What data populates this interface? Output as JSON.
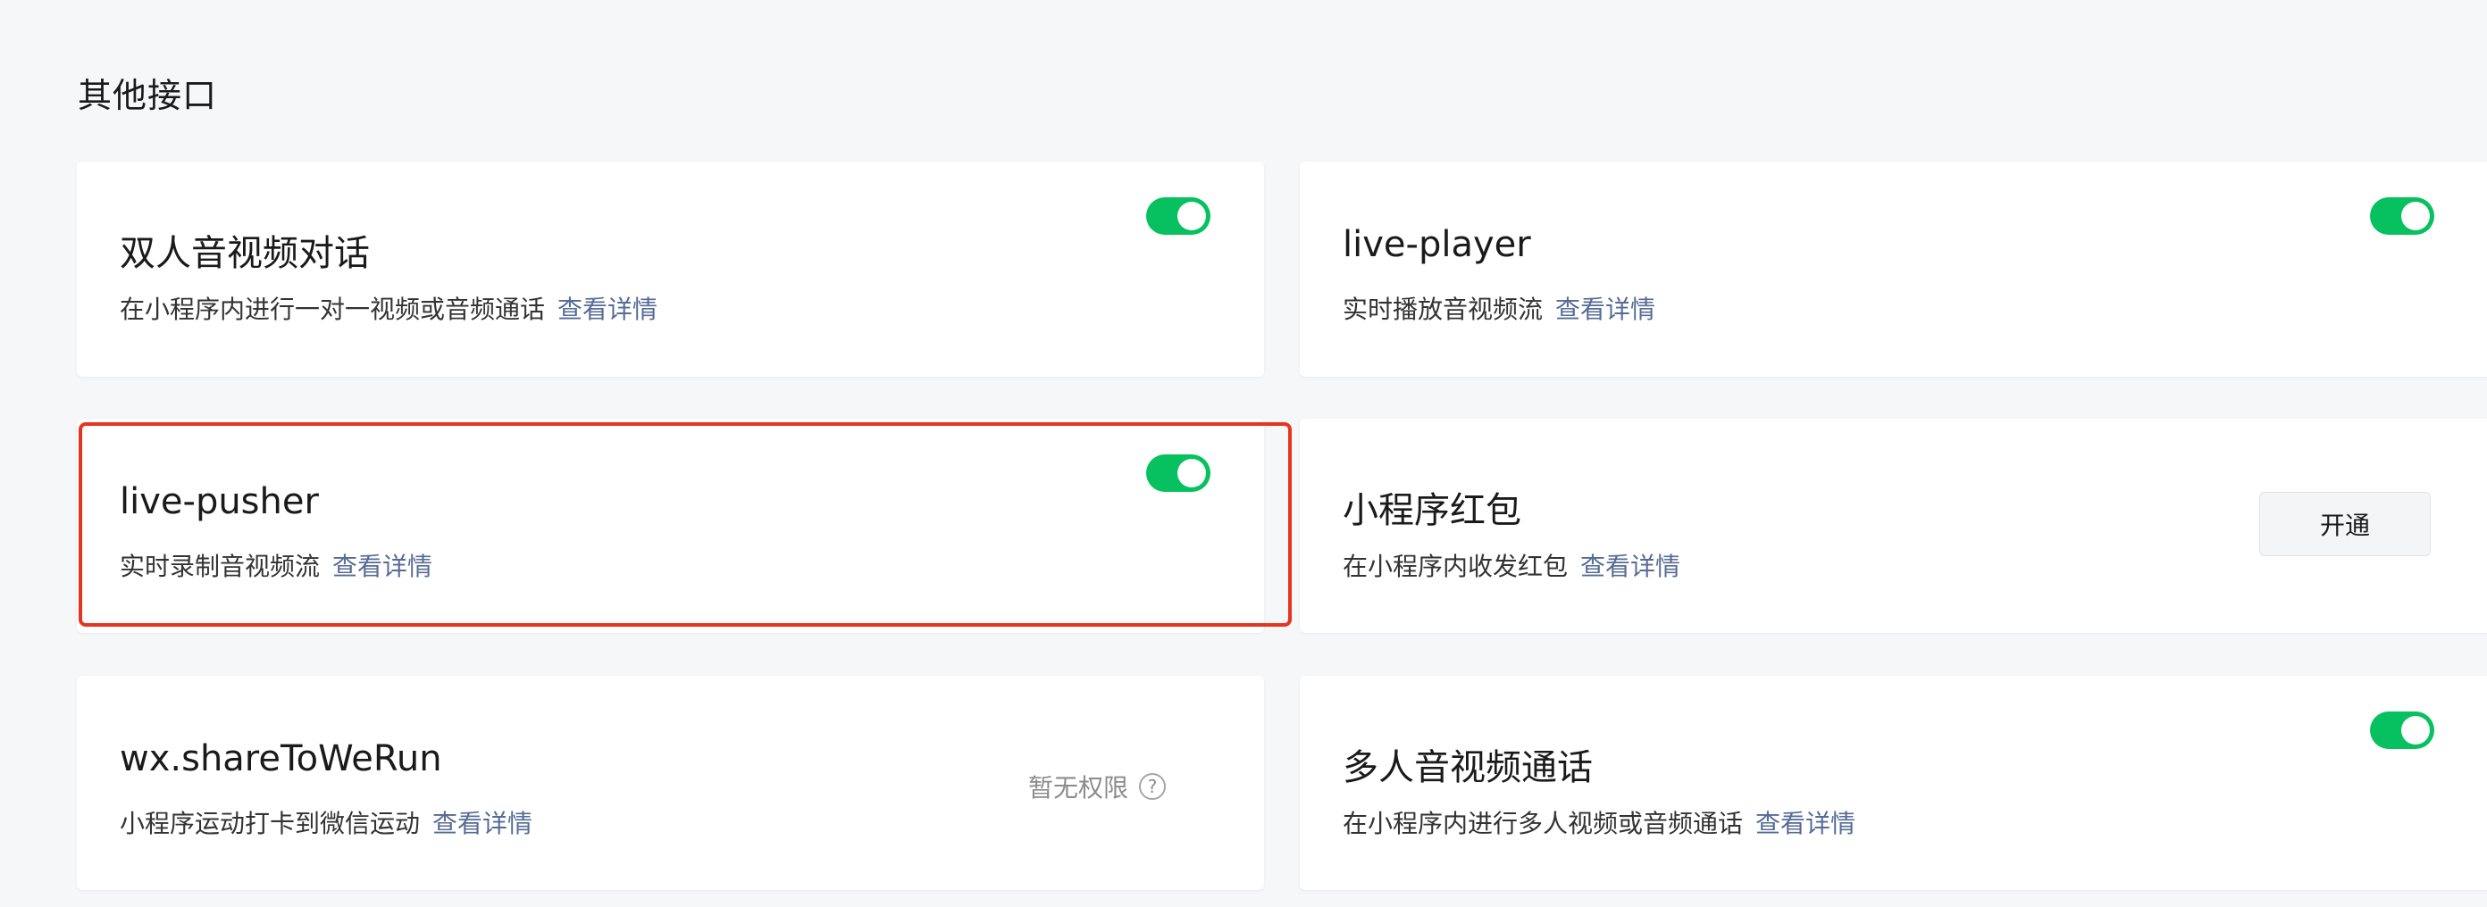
{
  "section": {
    "title": "其他接口"
  },
  "cards": {
    "c1": {
      "title": "双人音视频对话",
      "desc": "在小程序内进行一对一视频或音频通话",
      "link": "查看详情",
      "toggle_on": true
    },
    "c2": {
      "title": "live-player",
      "desc": "实时播放音视频流",
      "link": "查看详情",
      "toggle_on": true
    },
    "c3": {
      "title": "live-pusher",
      "desc": "实时录制音视频流",
      "link": "查看详情",
      "toggle_on": true
    },
    "c4": {
      "title": "小程序红包",
      "desc": "在小程序内收发红包",
      "link": "查看详情",
      "button": "开通"
    },
    "c5": {
      "title": "wx.shareToWeRun",
      "desc": "小程序运动打卡到微信运动",
      "link": "查看详情",
      "status": "暂无权限",
      "help_glyph": "?"
    },
    "c6": {
      "title": "多人音视频通话",
      "desc": "在小程序内进行多人视频或音频通话",
      "link": "查看详情",
      "toggle_on": true
    }
  },
  "colors": {
    "toggle_on": "#07c160",
    "link": "#576b95",
    "highlight": "#e8331f",
    "background": "#f6f7f9"
  },
  "icons": {
    "help": "question-circle-icon"
  }
}
